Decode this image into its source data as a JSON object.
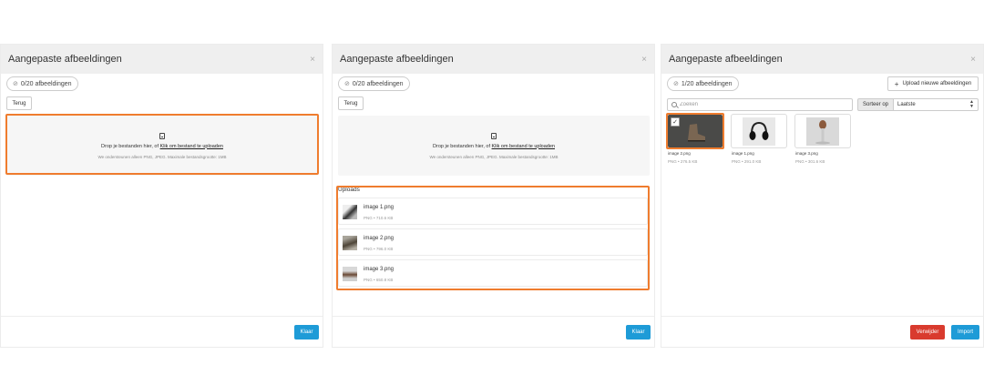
{
  "colors": {
    "highlight": "#ef7c2e",
    "primary_button": "#1e9bd7",
    "danger_button": "#d93b2e"
  },
  "panel1": {
    "title": "Aangepaste afbeeldingen",
    "close": "×",
    "counter": "0/20 afbeeldingen",
    "back": "Terug",
    "dropzone": {
      "icon": "file-icon",
      "text_prefix": "Drop je bestanden hier, of ",
      "link": "Klik om bestand te uploaden",
      "note": "We ondersteunen alleen PNG, JPEG. Maximale bestandsgrootte: 1MB"
    },
    "done": "Klaar"
  },
  "panel2": {
    "title": "Aangepaste afbeeldingen",
    "close": "×",
    "counter": "0/20 afbeeldingen",
    "back": "Terug",
    "dropzone": {
      "icon": "file-icon",
      "text_prefix": "Drop je bestanden hier, of ",
      "link": "Klik om bestand te uploaden",
      "note": "We ondersteunen alleen PNG, JPEG. Maximale bestandsgrootte: 1MB"
    },
    "uploads_label": "Uploads",
    "uploads": [
      {
        "name": "image 1.png",
        "meta": "PNG • 710.6 KB"
      },
      {
        "name": "image 2.png",
        "meta": "PNG • 796.0 KB"
      },
      {
        "name": "image 3.png",
        "meta": "PNG • 650.8 KB"
      }
    ],
    "done": "Klaar"
  },
  "panel3": {
    "title": "Aangepaste afbeeldingen",
    "close": "×",
    "counter": "1/20 afbeeldingen",
    "upload_new": "Upload nieuwe afbeeldingen",
    "search_placeholder": "Zoeken",
    "sort_label": "Sorteer op",
    "sort_value": "Laatste",
    "images": [
      {
        "name": "image 2.png",
        "meta": "PNG • 276.5 KB",
        "selected": true
      },
      {
        "name": "image 1.png",
        "meta": "PNG • 291.0 KB",
        "selected": false
      },
      {
        "name": "image 3.png",
        "meta": "PNG • 301.6 KB",
        "selected": false
      }
    ],
    "delete": "Verwijder",
    "import": "Import"
  }
}
